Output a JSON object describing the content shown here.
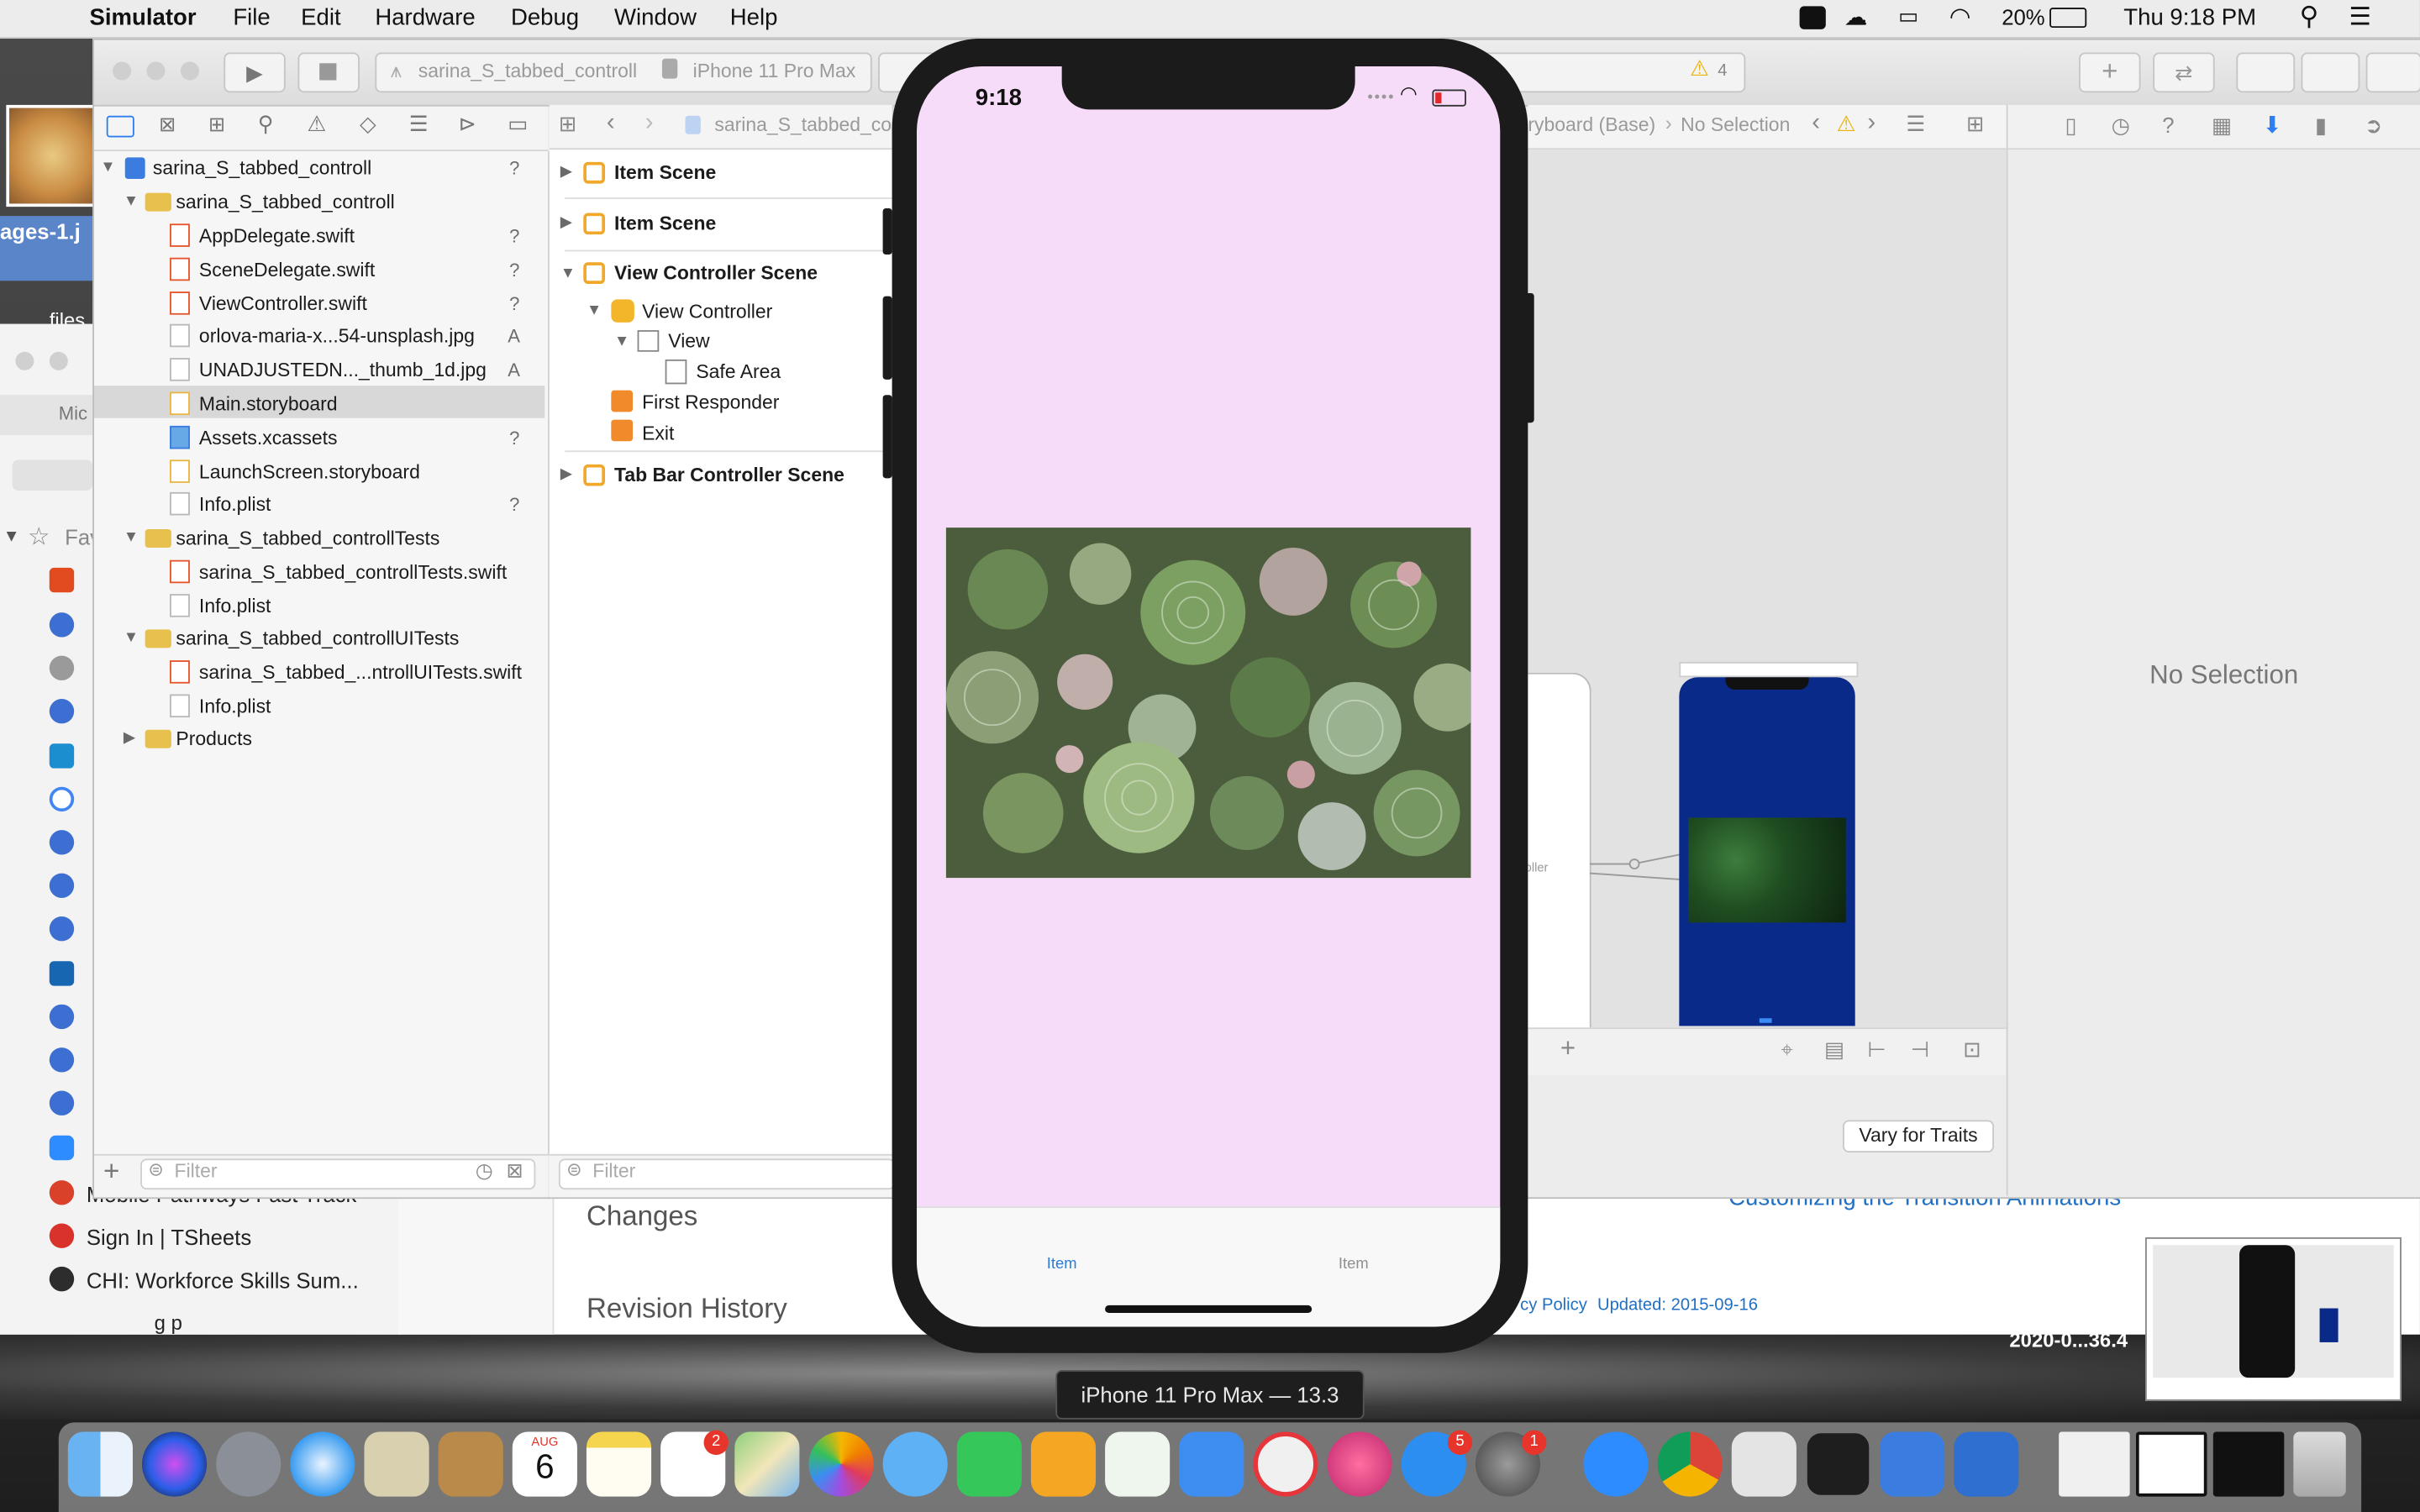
{
  "menubar": {
    "app": "Simulator",
    "items": [
      "File",
      "Edit",
      "Hardware",
      "Debug",
      "Window",
      "Help"
    ],
    "battery": "20%",
    "clock": "Thu 9:18 PM"
  },
  "xcode": {
    "scheme": "sarina_S_tabbed_controll",
    "device": "iPhone 11 Pro Max",
    "warnings": "4",
    "jumpbar_left": "sarina_S_tabbed_co",
    "jumpbar_right": "ryboard (Base)",
    "jumpbar_selection": "No Selection",
    "navigator": {
      "project": "sarina_S_tabbed_controll",
      "group1": "sarina_S_tabbed_controll",
      "files": [
        {
          "name": "AppDelegate.swift",
          "badge": "?"
        },
        {
          "name": "SceneDelegate.swift",
          "badge": "?"
        },
        {
          "name": "ViewController.swift",
          "badge": "?"
        },
        {
          "name": "orlova-maria-x...54-unsplash.jpg",
          "badge": "A"
        },
        {
          "name": "UNADJUSTEDN..._thumb_1d.jpg",
          "badge": "A"
        },
        {
          "name": "Main.storyboard",
          "badge": ""
        },
        {
          "name": "Assets.xcassets",
          "badge": "?"
        },
        {
          "name": "LaunchScreen.storyboard",
          "badge": ""
        },
        {
          "name": "Info.plist",
          "badge": "?"
        }
      ],
      "group2": "sarina_S_tabbed_controllTests",
      "group2_files": [
        "sarina_S_tabbed_controllTests.swift",
        "Info.plist"
      ],
      "group3": "sarina_S_tabbed_controllUITests",
      "group3_files": [
        "sarina_S_tabbed_...ntrollUITests.swift",
        "Info.plist"
      ],
      "products": "Products",
      "filter_placeholder": "Filter"
    },
    "outline": {
      "scene1": "Item Scene",
      "scene2": "Item Scene",
      "scene3": "View Controller Scene",
      "view_controller": "View Controller",
      "view": "View",
      "safe_area": "Safe Area",
      "first_responder": "First Responder",
      "exit": "Exit",
      "scene4": "Tab Bar Controller Scene",
      "filter_placeholder": "Filter"
    },
    "canvas": {
      "controller_label": "oller",
      "vary_for_traits": "Vary for Traits"
    },
    "inspector": {
      "no_selection": "No Selection"
    }
  },
  "simulator": {
    "time": "9:18",
    "tab1": "Item",
    "tab2": "Item",
    "tooltip": "iPhone 11 Pro Max — 13.3"
  },
  "browser": {
    "desktop_label_1": "ages-1.j",
    "desktop_label_2": "files",
    "tab_label": "Mic",
    "favorites": "Fav",
    "row_mobile": "Mobile Pathways Fast Track",
    "row_signin": "Sign In | TSheets",
    "row_chi": "CHI: Workforce Skills Sum...",
    "changes": "Changes",
    "revision": "Revision History",
    "link_customizing": "Customizing the Transition Animations",
    "privacy": "cy Policy",
    "updated": "Updated: 2015-09-16",
    "file_label": "2020-0...36.4",
    "under_text": "g p"
  },
  "dock": {
    "calendar_month": "AUG",
    "calendar_day": "6",
    "reminders_badge": "2",
    "appstore_badge": "5",
    "prefs_badge": "1"
  },
  "colors": {
    "simulator_bg": "#f7dcfa",
    "tab_active": "#2b7bd6",
    "tab_inactive": "#8f8f8f",
    "storyboard_blue": "#0a2a8a"
  }
}
